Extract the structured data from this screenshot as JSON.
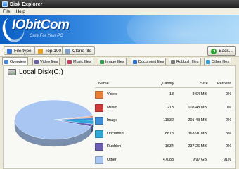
{
  "window": {
    "title": "Disk Explorer"
  },
  "menu": [
    "File",
    "Help"
  ],
  "banner": {
    "logo": "IObitCom",
    "tagline": "Care For Your PC"
  },
  "toolbar": {
    "buttons": [
      {
        "label": "File type",
        "icon": "file-type-icon",
        "color": "#3d78d8"
      },
      {
        "label": "Top 100",
        "icon": "top-100-icon",
        "color": "#e6a21f"
      },
      {
        "label": "Clone file",
        "icon": "clone-file-icon",
        "color": "#7e9fc9"
      }
    ],
    "back_label": "Back..."
  },
  "tabs": [
    {
      "label": "Overview",
      "icon": "overview-icon",
      "color": "#4a86d8"
    },
    {
      "label": "Video files",
      "icon": "video-files-icon",
      "color": "#6b5ea8"
    },
    {
      "label": "Music files",
      "icon": "music-files-icon",
      "color": "#c04060"
    },
    {
      "label": "Image files",
      "icon": "image-files-icon",
      "color": "#3a9b55"
    },
    {
      "label": "Document files",
      "icon": "document-files-icon",
      "color": "#2c6fd1"
    },
    {
      "label": "Rubbish files",
      "icon": "rubbish-files-icon",
      "color": "#7a7a7a"
    },
    {
      "label": "Other files",
      "icon": "other-files-icon",
      "color": "#3aa0d8"
    }
  ],
  "overview": {
    "disk_title": "Local Disk(C:)",
    "columns": {
      "name": "Name",
      "quantity": "Quantity",
      "size": "Size",
      "percent": "Percent"
    },
    "rows": [
      {
        "name": "Video",
        "quantity": "18",
        "size": "8.64 MB",
        "percent": "0%",
        "color": "#e8803a"
      },
      {
        "name": "Music",
        "quantity": "213",
        "size": "108.48 MB",
        "percent": "0%",
        "color": "#d23b3b"
      },
      {
        "name": "Image",
        "quantity": "11832",
        "size": "291.43 MB",
        "percent": "2%",
        "color": "#3e8fd8"
      },
      {
        "name": "Document",
        "quantity": "8878",
        "size": "363.91 MB",
        "percent": "3%",
        "color": "#2fa8d8"
      },
      {
        "name": "Rubbish",
        "quantity": "1634",
        "size": "237.26 MB",
        "percent": "2%",
        "color": "#6a5fb0"
      },
      {
        "name": "Other",
        "quantity": "47083",
        "size": "9.97 GB",
        "percent": "91%",
        "color": "#a9c6f2"
      }
    ]
  }
}
